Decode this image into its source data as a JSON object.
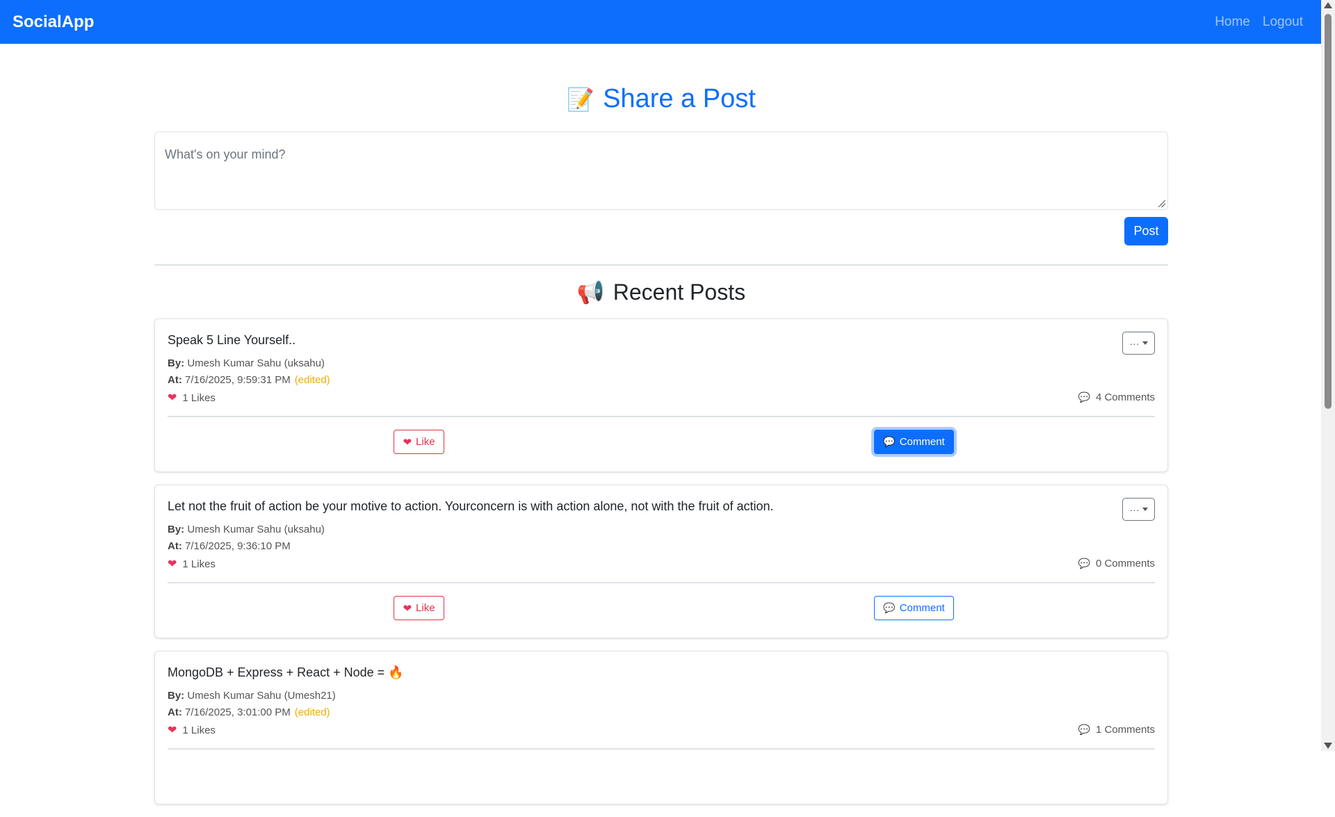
{
  "navbar": {
    "brand": "SocialApp",
    "links": [
      "Home",
      "Logout"
    ]
  },
  "composer": {
    "heading": "Share a Post",
    "heading_icon": "memo-icon",
    "placeholder": "What's on your mind?",
    "post_label": "Post"
  },
  "feed": {
    "heading": "Recent Posts",
    "heading_icon": "megaphone-icon",
    "by_label": "By:",
    "at_label": "At:",
    "like_label": "Like",
    "comment_label": "Comment",
    "menu_label": "···",
    "posts": [
      {
        "text": "Speak 5 Line Yourself..",
        "author": "Umesh Kumar Sahu (uksahu)",
        "timestamp": "7/16/2025, 9:59:31 PM",
        "edited": "(edited)",
        "likes": "1 Likes",
        "comments": "4 Comments"
      },
      {
        "text": "Let not the fruit of action be your motive to action. Yourconcern is with action alone, not with the fruit of action.",
        "author": "Umesh Kumar Sahu (uksahu)",
        "timestamp": "7/16/2025, 9:36:10 PM",
        "edited": "",
        "likes": "1 Likes",
        "comments": "0 Comments"
      },
      {
        "text": "MongoDB + Express + React + Node = 🔥",
        "author": "Umesh Kumar Sahu (Umesh21)",
        "timestamp": "7/16/2025, 3:01:00 PM",
        "edited": "(edited)",
        "likes": "1 Likes",
        "comments": "1 Comments"
      }
    ]
  },
  "colors": {
    "primary": "#0d6efd",
    "danger": "#dc3545",
    "edited": "#f0ad00"
  }
}
